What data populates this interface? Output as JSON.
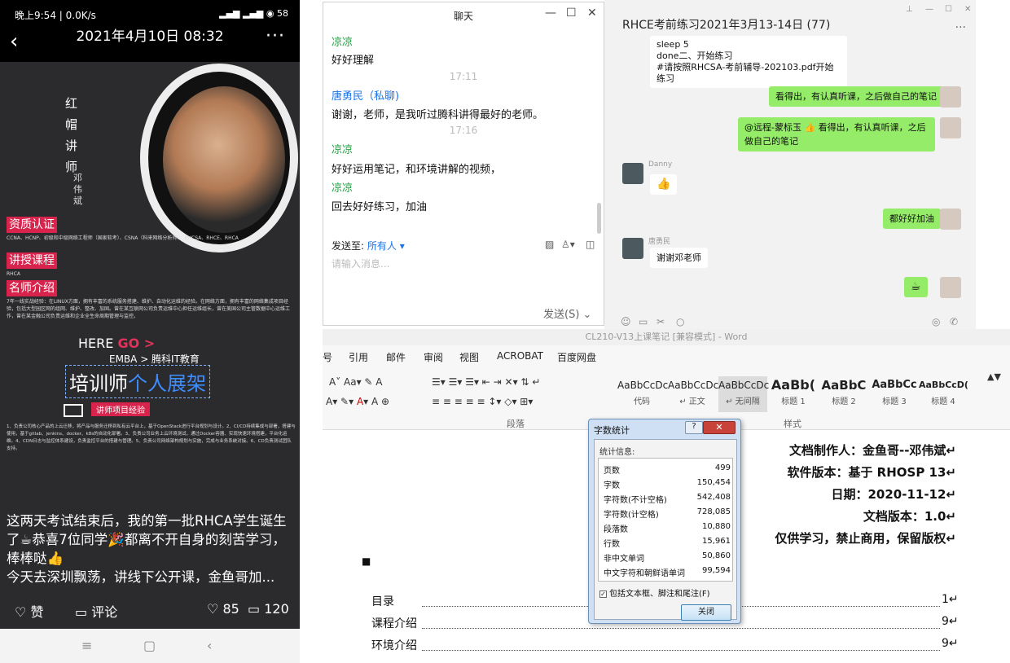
{
  "phone": {
    "status_left": "晚上9:54 | 0.0K/s",
    "status_right": "58",
    "title": "2021年4月10日 08:32",
    "back": "‹",
    "more": "···",
    "poster": {
      "vtitle": "红帽讲师",
      "vname": "邓伟斌",
      "sec1": "资质认证",
      "sec1_text": "CCNA、HCNP、初级和中级网络工程师（国家软考）、CSNA（科来网络分析师）、RHCSA、RHCE、RHCA",
      "sec2": "讲授课程",
      "sec2_text": "RHCA",
      "sec3": "名师介绍",
      "sec3_text": "7年一线实战经验：在LINUX方面，拥有丰富的系统服务搭建、维护、自动化运维的经验。在网络方面，拥有丰富的网络集成项目经验，包括大型园区网的组网、维护、整改、加固。曾在某互联网公司负责运维中心担任运维组长，曾在美国公司主管数据中心运维工作，曾在某金融公司负责运维和企业全生命周期管理与监控。",
      "here": "HERE",
      "go": "GO >",
      "emba": "EMBA > 腾科IT教育",
      "big_white": "培训师",
      "big_blue": "个人展架",
      "proj": "讲师项目经验",
      "proj_text": "1、负责公司核心产品的上云迁移，将产品与服务迁移到私有云平台上，基于OpenStack进行平台规划与设计。2、CI/CD持续集成与部署，搭建与使用，基于gitlab、jenkins、docker、k8s的自动化部署。3、负责公司业务上云环境测试，通过Docker容器、实现快速环境搭建，平台化运维。4、CDN日志与监控体系建设，负责监控平台的搭建与管理。5、负责公司网络架构规划与实施，完成与业务系统对接。6、CD负责测试团队支持。"
    },
    "caption": "这两天考试结束后，我的第一批RHCA学生诞生了☕恭喜7位同学🎉都离不开自身的刻苦学习，棒棒哒👍",
    "caption2": "今天去深圳飘荡，讲线下公开课，金鱼哥加...",
    "like_label": "赞",
    "comment_label": "评论",
    "like_count": "85",
    "comment_count": "120",
    "nav": [
      "≡",
      "▢",
      "‹"
    ]
  },
  "qq": {
    "title": "聊天",
    "msgs": [
      {
        "name": "凉凉",
        "text": "好好理解"
      },
      {
        "time": "17:11"
      },
      {
        "name": "唐勇民（私聊)",
        "text": "谢谢，老师，是我听过腾科讲得最好的老师。"
      },
      {
        "time": "17:16"
      },
      {
        "name": "凉凉",
        "text": "好好运用笔记，和环境讲解的视频，"
      },
      {
        "name": "凉凉",
        "text": "回去好好练习，加油"
      }
    ],
    "sendto_label": "发送至:",
    "sendto_value": "所有人 ▾",
    "placeholder": "请输入消息...",
    "send": "发送(S)"
  },
  "wechat": {
    "title": "RHCE考前练习2021年3月13-14日 (77)",
    "top_msg": [
      "sleep 5",
      "done二、开始练习",
      "#请按照RHCSA-考前辅导-202103.pdf开始练习"
    ],
    "m1": "看得出，有认真听课，之后做自己的笔记",
    "m2": "@远程-蒙标玉 👍 看得出，有认真听课，之后做自己的笔记",
    "danny": "Danny",
    "m3": "👍",
    "m4": "都好好加油",
    "tang": "唐勇民",
    "m5": "谢谢邓老师",
    "m6": "☕"
  },
  "word": {
    "title": "CL210-V13上课笔记 [兼容模式] - Word",
    "tabs": [
      "引用",
      "邮件",
      "审阅",
      "视图",
      "ACROBAT",
      "百度网盘"
    ],
    "styles": [
      {
        "a": "AaBbCcDc",
        "b": "代码"
      },
      {
        "a": "AaBbCcDc",
        "b": "↵ 正文"
      },
      {
        "a": "AaBbCcDc",
        "b": "↵ 无间隔"
      },
      {
        "a": "AaBb(",
        "b": "标题 1"
      },
      {
        "a": "AaBbC",
        "b": "标题 2"
      },
      {
        "a": "AaBbCc",
        "b": "标题 3"
      },
      {
        "a": "AaBbCcD(",
        "b": "标题 4"
      }
    ],
    "grp_para": "段落",
    "grp_style": "样式",
    "doc_lines": [
      "文档制作人：金鱼哥--邓伟斌↵",
      "软件版本：基于 RHOSP  13↵",
      "日期：2020-11-12↵",
      "文档版本：1.0↵",
      "仅供学习，禁止商用，保留版权↵"
    ],
    "toc": [
      {
        "t": "目录",
        "p": "1↵"
      },
      {
        "t": "课程介绍",
        "p": "9↵"
      },
      {
        "t": "环境介绍",
        "p": "9↵"
      }
    ]
  },
  "dialog": {
    "title": "字数统计",
    "label": "统计信息:",
    "rows": [
      {
        "k": "页数",
        "v": "499"
      },
      {
        "k": "字数",
        "v": "150,454"
      },
      {
        "k": "字符数(不计空格)",
        "v": "542,408"
      },
      {
        "k": "字符数(计空格)",
        "v": "728,085"
      },
      {
        "k": "段落数",
        "v": "10,880"
      },
      {
        "k": "行数",
        "v": "15,961"
      },
      {
        "k": "非中文单词",
        "v": "50,860"
      },
      {
        "k": "中文字符和朝鲜语单词",
        "v": "99,594"
      }
    ],
    "check": "包括文本框、脚注和尾注(F)",
    "close": "关闭"
  }
}
